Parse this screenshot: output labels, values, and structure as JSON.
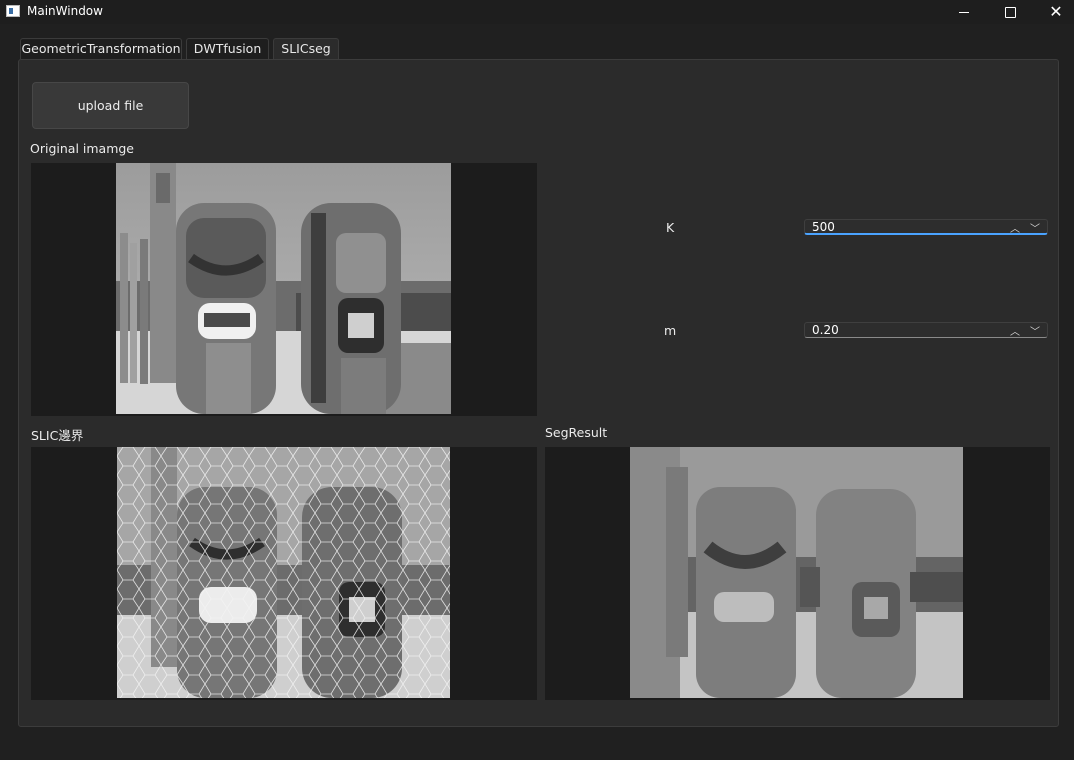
{
  "window": {
    "title": "MainWindow"
  },
  "tabs": [
    {
      "label": "GeometricTransformation"
    },
    {
      "label": "DWTfusion"
    },
    {
      "label": "SLICseg"
    }
  ],
  "active_tab": "SLICseg",
  "upload_button": {
    "label": "upload file"
  },
  "labels": {
    "original": "Original imamge",
    "slic": "SLIC邊界",
    "seg": "SegResult"
  },
  "params": {
    "k": {
      "label": "K",
      "value": "500"
    },
    "m": {
      "label": "m",
      "value": "0.20"
    }
  },
  "icons": {
    "app": "app-window-icon",
    "minimize": "minimize-icon",
    "maximize": "maximize-icon",
    "close": "close-icon",
    "up": "chevron-up-icon",
    "down": "chevron-down-icon"
  },
  "colors": {
    "background": "#202020",
    "panel": "#2b2b2b",
    "focus_accent": "#4aa3ff"
  }
}
